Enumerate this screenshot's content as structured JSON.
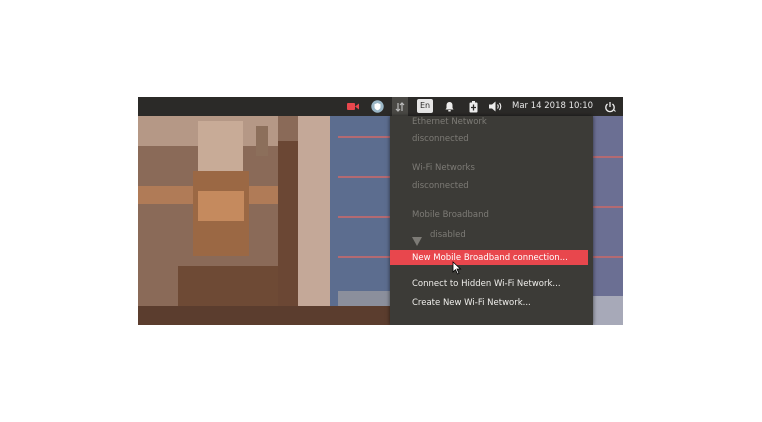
{
  "panel": {
    "language": "En",
    "clock": "Mar 14 2018 10:10",
    "icons": [
      "camera-icon",
      "shield-icon",
      "network-icon",
      "bell-icon",
      "battery-icon",
      "volume-icon",
      "power-icon"
    ]
  },
  "menu": {
    "wired_header": "Ethernet Network",
    "wired_status": "disconnected",
    "wifi_header": "Wi-Fi Networks",
    "wifi_status": "disconnected",
    "mobile_header": "Mobile Broadband",
    "mobile_device": "disabled",
    "new_mobile_connection": "New Mobile Broadband connection...",
    "connect_hidden_wifi": "Connect to Hidden Wi-Fi Network...",
    "create_new_wifi": "Create New Wi-Fi Network..."
  },
  "colors": {
    "panel_bg": "#2b2a28",
    "menu_bg": "#3c3b37",
    "highlight": "#e8474d"
  }
}
